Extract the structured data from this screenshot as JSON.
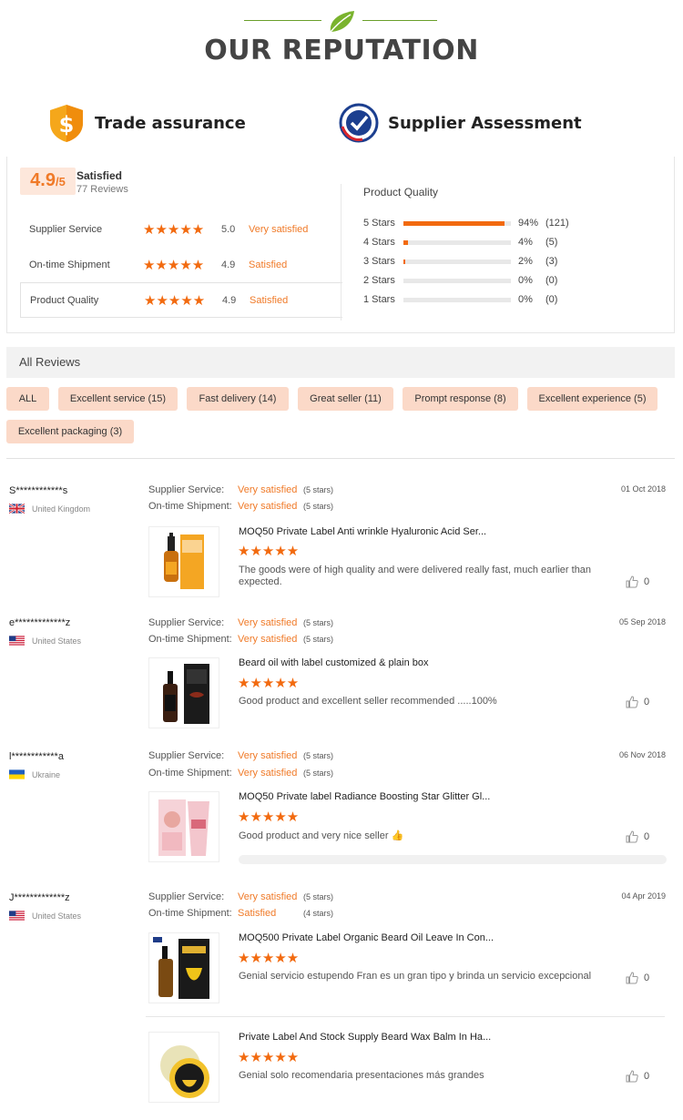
{
  "header": {
    "title": "OUR REPUTATION",
    "trade_assurance": "Trade assurance",
    "supplier_assessment": "Supplier Assessment"
  },
  "ratings": {
    "score": "4.9",
    "score_suffix": "/5",
    "satisfied": "Satisfied",
    "reviews_count": "77 Reviews",
    "rows": [
      {
        "label": "Supplier Service",
        "value": "5.0",
        "word": "Very satisfied"
      },
      {
        "label": "On-time Shipment",
        "value": "4.9",
        "word": "Satisfied"
      },
      {
        "label": "Product Quality",
        "value": "4.9",
        "word": "Satisfied"
      }
    ],
    "distribution_title": "Product Quality",
    "distribution": [
      {
        "label": "5 Stars",
        "percent": "94%",
        "count": "(121)",
        "fraction": 0.94
      },
      {
        "label": "4 Stars",
        "percent": "4%",
        "count": "(5)",
        "fraction": 0.04
      },
      {
        "label": "3 Stars",
        "percent": "2%",
        "count": "(3)",
        "fraction": 0.02
      },
      {
        "label": "2 Stars",
        "percent": "0%",
        "count": "(0)",
        "fraction": 0
      },
      {
        "label": "1 Stars",
        "percent": "0%",
        "count": "(0)",
        "fraction": 0
      }
    ]
  },
  "all_reviews": {
    "title": "All Reviews",
    "tags": [
      "ALL",
      "Excellent service (15)",
      "Fast delivery (14)",
      "Great seller (11)",
      "Prompt response (8)",
      "Excellent experience (5)",
      "Excellent packaging (3)"
    ]
  },
  "labels": {
    "supplier_service": "Supplier Service:",
    "ontime_shipment": "On-time Shipment:",
    "stars_glyph": "★★★★★"
  },
  "reviews": [
    {
      "user": "S************s",
      "country": "United Kingdom",
      "date": "01 Oct 2018",
      "service_word": "Very satisfied",
      "service_stars": "(5 stars)",
      "shipment_word": "Very satisfied",
      "shipment_stars": "(5 stars)",
      "products": [
        {
          "title": "MOQ50 Private Label Anti wrinkle Hyaluronic Acid Ser...",
          "comment": "The goods were of high quality and were delivered really fast, much earlier than expected.",
          "likes": "0"
        }
      ]
    },
    {
      "user": "e*************z",
      "country": "United States",
      "date": "05 Sep 2018",
      "service_word": "Very satisfied",
      "service_stars": "(5 stars)",
      "shipment_word": "Very satisfied",
      "shipment_stars": "(5 stars)",
      "products": [
        {
          "title": "Beard oil with label customized & plain box",
          "comment": "Good product and excellent seller recommended .....100%",
          "likes": "0"
        }
      ]
    },
    {
      "user": "l************a",
      "country": "Ukraine",
      "date": "06 Nov 2018",
      "service_word": "Very satisfied",
      "service_stars": "(5 stars)",
      "shipment_word": "Very satisfied",
      "shipment_stars": "(5 stars)",
      "products": [
        {
          "title": "MOQ50 Private label Radiance Boosting Star Glitter Gl...",
          "comment": "Good product and very nice seller 👍",
          "likes": "0"
        }
      ]
    },
    {
      "user": "J*************z",
      "country": "United States",
      "date": "04 Apr 2019",
      "service_word": "Very satisfied",
      "service_stars": "(5 stars)",
      "shipment_word": "Satisfied",
      "shipment_stars": "(4 stars)",
      "products": [
        {
          "title": "MOQ500 Private Label Organic Beard Oil Leave In Con...",
          "comment": "Genial servicio estupendo Fran es un gran tipo y brinda un servicio excepcional",
          "likes": "0"
        },
        {
          "title": "Private Label And Stock Supply Beard Wax Balm In Ha...",
          "comment": "Genial solo recomendaria presentaciones más grandes",
          "likes": "0"
        }
      ]
    }
  ],
  "colors": {
    "accent": "#f26a0f",
    "accent_light": "#fbd9c8",
    "green": "#6a9f2a"
  }
}
